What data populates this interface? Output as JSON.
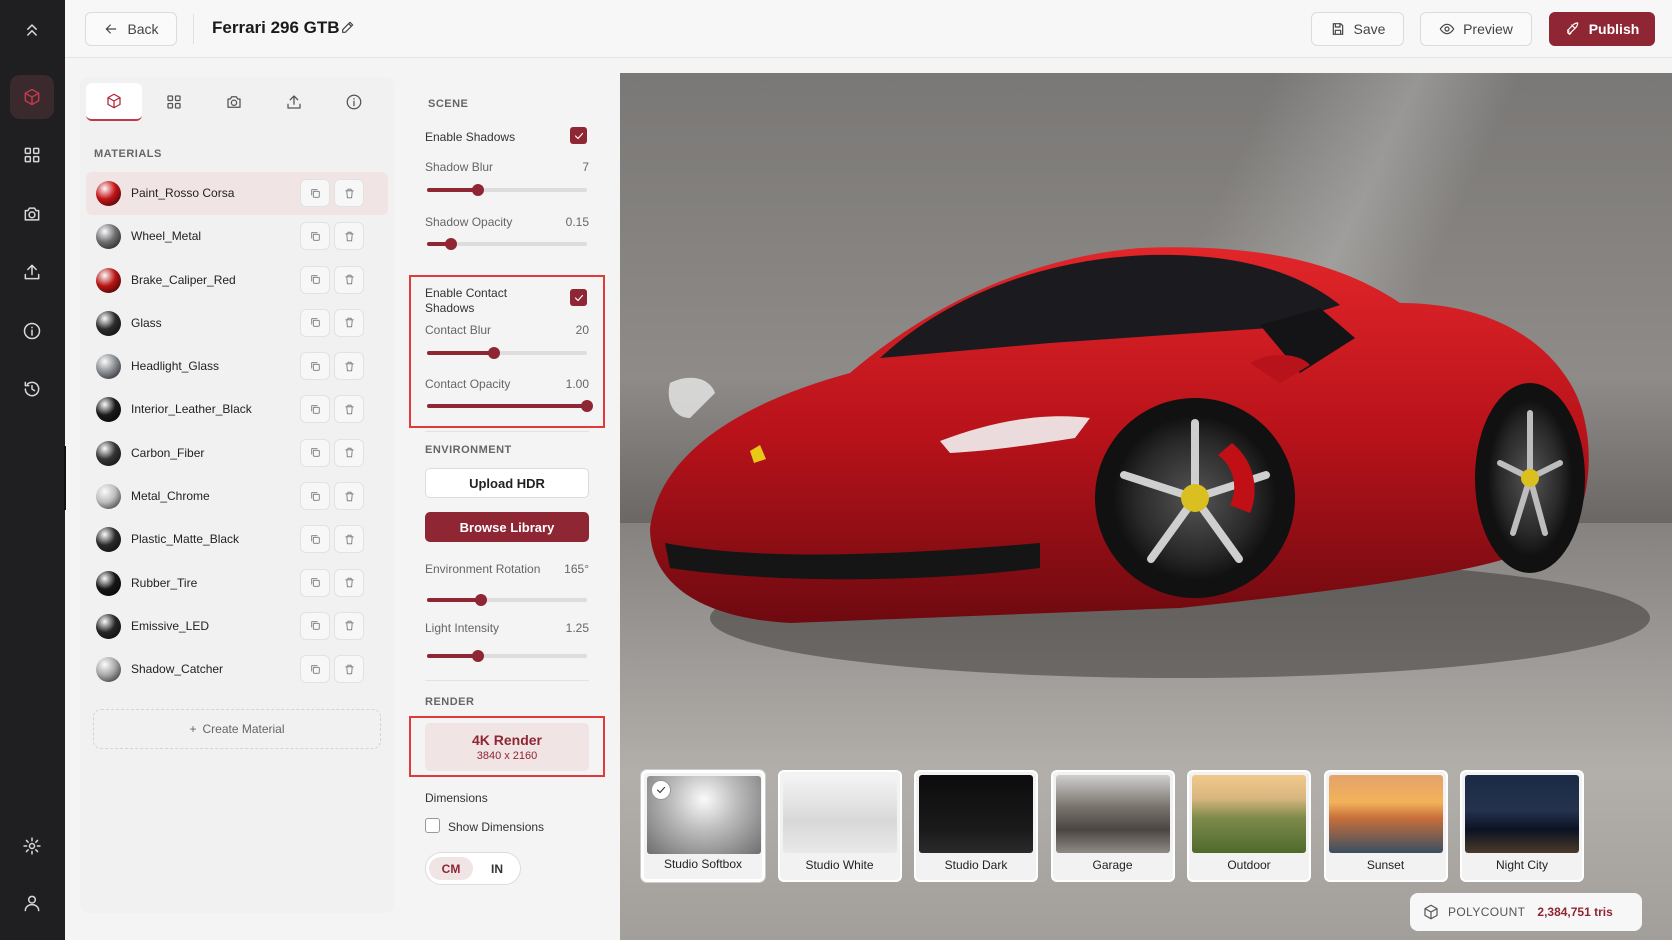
{
  "header": {
    "back_label": "Back",
    "title": "Ferrari 296 GTB",
    "save_label": "Save",
    "preview_label": "Preview",
    "publish_label": "Publish"
  },
  "sidebar_rail": {
    "items": [
      "collapse-icon",
      "box-icon",
      "grid-icon",
      "camera-icon",
      "upload-icon",
      "info-icon",
      "history-icon",
      "settings-icon",
      "user-icon"
    ],
    "active": "box-icon"
  },
  "materials_panel": {
    "tabs": [
      "box-icon",
      "grid-icon",
      "camera-icon",
      "upload-icon",
      "info-icon"
    ],
    "active_tab": "box-icon",
    "section_label": "MATERIALS",
    "items": [
      {
        "name": "Paint_Rosso Corsa",
        "swatch": "#c41418",
        "active": true
      },
      {
        "name": "Wheel_Metal",
        "swatch": "#6f6f72"
      },
      {
        "name": "Brake_Caliper_Red",
        "swatch": "#b81414"
      },
      {
        "name": "Glass",
        "swatch": "#2c2c2e"
      },
      {
        "name": "Headlight_Glass",
        "swatch": "#8a8d92"
      },
      {
        "name": "Interior_Leather_Black",
        "swatch": "#1a1a1a"
      },
      {
        "name": "Carbon_Fiber",
        "swatch": "#353535"
      },
      {
        "name": "Metal_Chrome",
        "swatch": "#bdbdbd"
      },
      {
        "name": "Plastic_Matte_Black",
        "swatch": "#2a2a2a"
      },
      {
        "name": "Rubber_Tire",
        "swatch": "#161616"
      },
      {
        "name": "Emissive_LED",
        "swatch": "#262626"
      },
      {
        "name": "Shadow_Catcher",
        "swatch": "#a8a8a8"
      }
    ],
    "create_label": "Create Material"
  },
  "scene_panel": {
    "scene_label": "SCENE",
    "enable_shadows": {
      "label": "Enable Shadows",
      "checked": true
    },
    "shadow_blur": {
      "label": "Shadow Blur",
      "value": "7",
      "fraction": 0.32
    },
    "shadow_opacity": {
      "label": "Shadow Opacity",
      "value": "0.15",
      "fraction": 0.15
    },
    "enable_contact_shadows": {
      "label": "Enable Contact Shadows",
      "checked": true
    },
    "contact_blur": {
      "label": "Contact Blur",
      "value": "20",
      "fraction": 0.42
    },
    "contact_opacity": {
      "label": "Contact Opacity",
      "value": "1.00",
      "fraction": 1.0
    },
    "environment_label": "ENVIRONMENT",
    "upload_hdr_label": "Upload HDR",
    "browse_library_label": "Browse Library",
    "env_rotation": {
      "label": "Environment Rotation",
      "value": "165°",
      "fraction": 0.34
    },
    "light_intensity": {
      "label": "Light Intensity",
      "value": "1.25",
      "fraction": 0.32
    },
    "render_label": "RENDER",
    "render_card": {
      "title": "4K Render",
      "subtitle": "3840 x 2160"
    },
    "dimensions_label": "Dimensions",
    "show_dimensions": {
      "label": "Show Dimensions",
      "checked": false
    },
    "units": [
      "CM",
      "IN"
    ],
    "active_unit": "CM"
  },
  "viewport": {
    "environments": [
      {
        "label": "Studio Softbox",
        "selected": true,
        "thumb": "softbox"
      },
      {
        "label": "Studio White",
        "thumb": "white"
      },
      {
        "label": "Studio Dark",
        "thumb": "dark"
      },
      {
        "label": "Garage",
        "thumb": "garage"
      },
      {
        "label": "Outdoor",
        "thumb": "outdoor"
      },
      {
        "label": "Sunset",
        "thumb": "sunset"
      },
      {
        "label": "Night City",
        "thumb": "night"
      }
    ],
    "polycount_label": "POLYCOUNT",
    "polycount_value": "2,384,751 tris"
  },
  "colors": {
    "accent": "#8e2633",
    "accent_light": "#f1e4e5",
    "highlight_red": "#e03a3a",
    "rail_bg": "#1f1f22",
    "car_red": "#c41418"
  }
}
